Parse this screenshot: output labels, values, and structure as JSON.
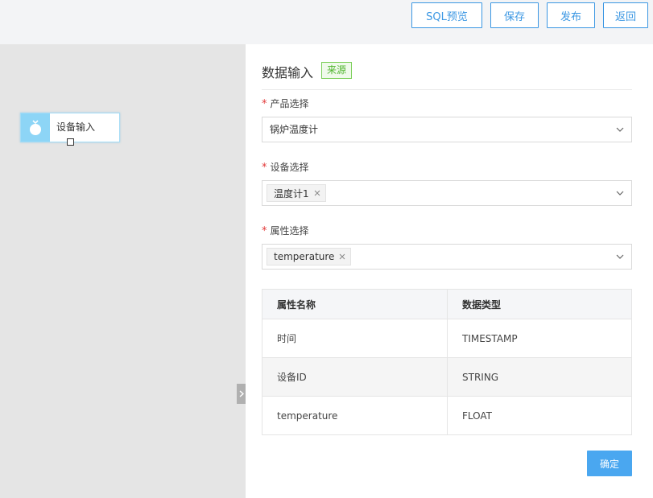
{
  "toolbar": {
    "sql_preview": "SQL预览",
    "save": "保存",
    "publish": "发布",
    "back": "返回"
  },
  "canvas": {
    "node_label": "设备输入"
  },
  "panel": {
    "title": "数据输入",
    "tag": "来源",
    "product": {
      "label": "产品选择",
      "value": "锅炉温度计"
    },
    "device": {
      "label": "设备选择",
      "chips": [
        "温度计1"
      ]
    },
    "attribute": {
      "label": "属性选择",
      "chips": [
        "temperature"
      ]
    },
    "table": {
      "headers": [
        "属性名称",
        "数据类型"
      ],
      "rows": [
        [
          "时间",
          "TIMESTAMP"
        ],
        [
          "设备ID",
          "STRING"
        ],
        [
          "temperature",
          "FLOAT"
        ]
      ]
    },
    "confirm": "确定"
  },
  "colors": {
    "accent": "#3b97e3",
    "confirm_bg": "#4aa7f0",
    "node_icon_bg": "#8dd5f6",
    "tag_green": "#52b631",
    "required_red": "#e23b3b"
  }
}
